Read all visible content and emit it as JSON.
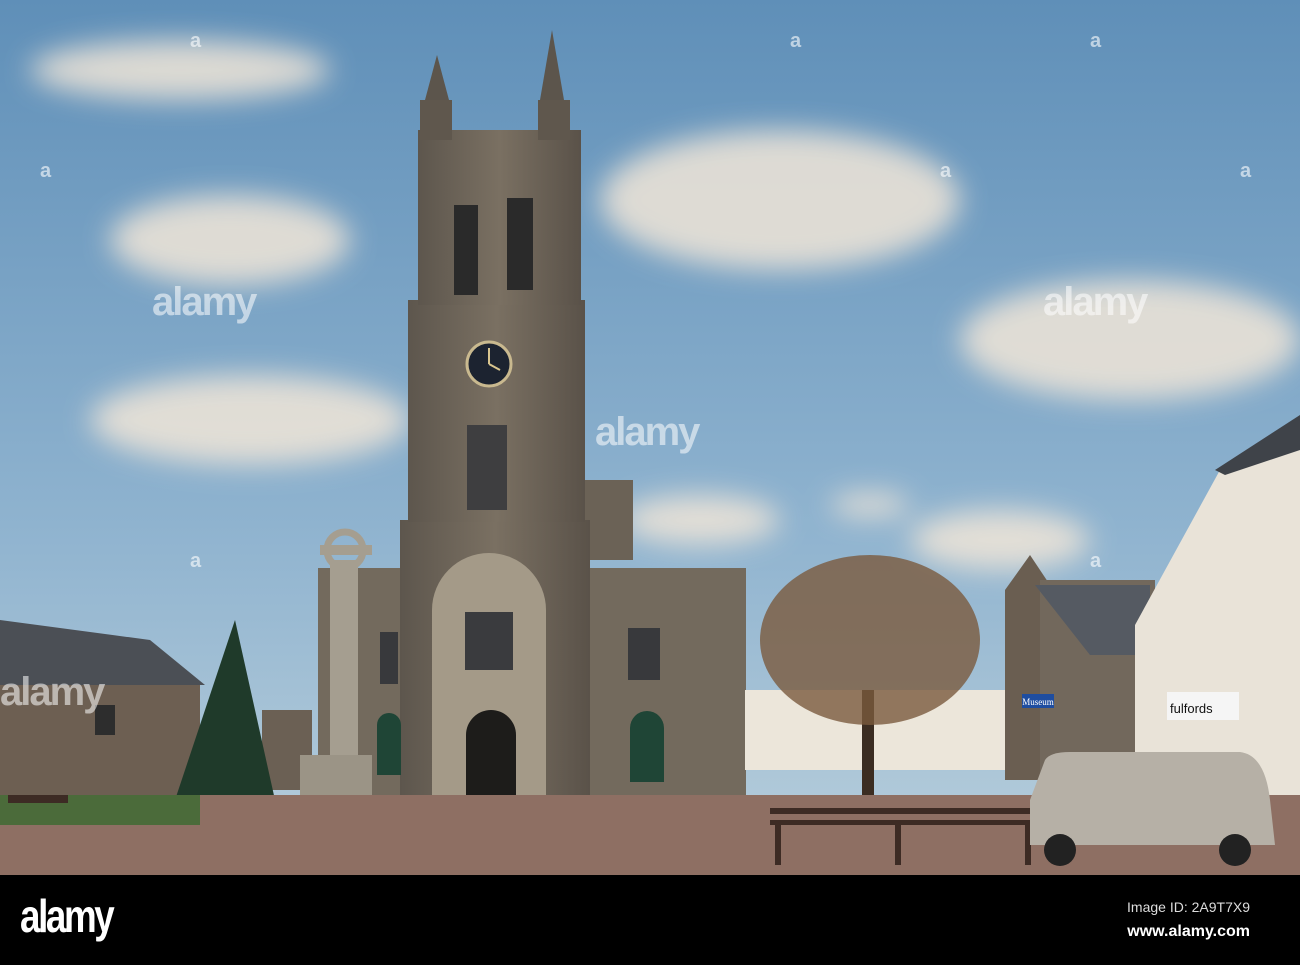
{
  "photo": {
    "signs": {
      "museum": "Museum",
      "shop": "fulfords"
    }
  },
  "watermark": {
    "text": "alamy",
    "letter": "a"
  },
  "footer": {
    "logo": "alamy",
    "image_id": "Image ID: 2A9T7X9",
    "url": "www.alamy.com"
  },
  "colors": {
    "sky_top": "#5f8fb8",
    "sky_bottom": "#a9c6d8",
    "stone": "#6f665a",
    "footer": "#000000"
  }
}
